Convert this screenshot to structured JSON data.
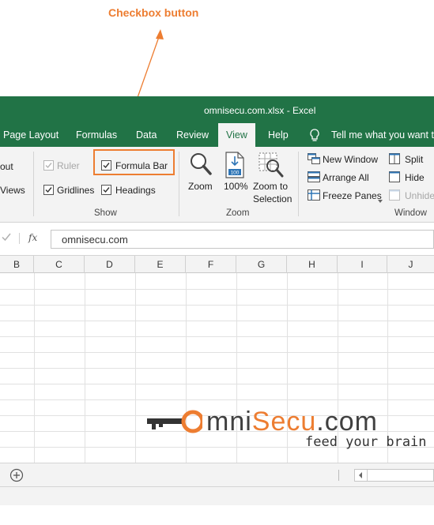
{
  "annotation": {
    "label": "Checkbox button",
    "color": "#ed7d31"
  },
  "window": {
    "title": "omnisecu.com.xlsx  -  Excel",
    "accent": "#217346"
  },
  "tabs": [
    {
      "label": "Page Layout"
    },
    {
      "label": "Formulas"
    },
    {
      "label": "Data"
    },
    {
      "label": "Review"
    },
    {
      "label": "View",
      "active": true
    },
    {
      "label": "Help"
    }
  ],
  "tell_me": {
    "icon": "lightbulb-icon",
    "label": "Tell me what you want to"
  },
  "ribbon": {
    "views_group": {
      "item1": "out",
      "item2": "Views"
    },
    "show_group": {
      "label": "Show",
      "ruler": {
        "label": "Ruler",
        "checked": true,
        "enabled": false
      },
      "formula_bar": {
        "label": "Formula Bar",
        "checked": true
      },
      "gridlines": {
        "label": "Gridlines",
        "checked": true
      },
      "headings": {
        "label": "Headings",
        "checked": true
      }
    },
    "zoom_group": {
      "label": "Zoom",
      "zoom": "Zoom",
      "zoom_100": "100%",
      "zoom_selection_1": "Zoom to",
      "zoom_selection_2": "Selection"
    },
    "window_group": {
      "label": "Window",
      "new_window": "New Window",
      "arrange_all": "Arrange All",
      "freeze_panes": "Freeze Panes",
      "split": "Split",
      "hide": "Hide",
      "unhide": "Unhide"
    }
  },
  "formula_bar": {
    "fx": "fx",
    "value": "omnisecu.com"
  },
  "columns": [
    "B",
    "C",
    "D",
    "E",
    "F",
    "G",
    "H",
    "I",
    "J"
  ],
  "watermark": {
    "brand_1": "mni",
    "brand_2": "Secu",
    "brand_3": ".com",
    "tagline": "feed your brain"
  }
}
